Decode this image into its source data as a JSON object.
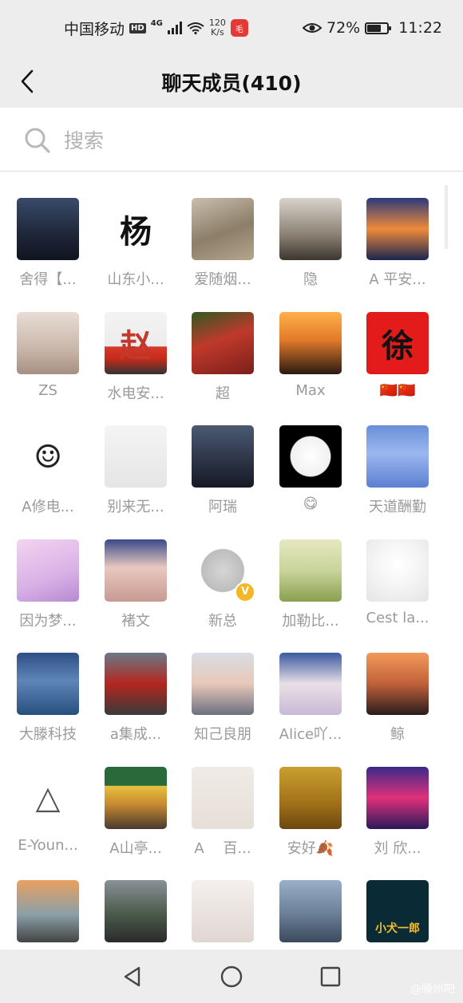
{
  "status_bar": {
    "carrier": "中国移动",
    "hd": "HD",
    "network": "4G",
    "speed_value": "120",
    "speed_unit": "K/s",
    "app_badge_text": "毛",
    "battery_percent": "72%",
    "battery_level": 0.72,
    "time": "11:22"
  },
  "header": {
    "title": "聊天成员(410)"
  },
  "search": {
    "placeholder": "搜索",
    "value": ""
  },
  "members": [
    {
      "name": "舍得【...",
      "bg": "linear-gradient(180deg,#3a4a6a 0%,#1d2638 60%,#10141f 100%)",
      "mark": "",
      "mark_color": "#ffffff"
    },
    {
      "name": "山东小...",
      "bg": "#ffffff",
      "mark": "杨",
      "mark_color": "#111111"
    },
    {
      "name": "爱随烟...",
      "bg": "linear-gradient(160deg,#c9bfae 0%,#8c7e68 55%,#b5a58d 100%)",
      "mark": "",
      "mark_color": "#ffffff"
    },
    {
      "name": "隐",
      "bg": "linear-gradient(180deg,#d9d4cc 0%,#8a7f72 60%,#3c3630 100%)",
      "mark": "",
      "mark_color": "#ffffff"
    },
    {
      "name": "A 平安...",
      "bg": "linear-gradient(180deg,#2b3a7a 0%,#f08a3a 50%,#1a2550 100%)",
      "mark": "",
      "mark_color": "#ffffff"
    },
    {
      "name": "ZS",
      "bg": "linear-gradient(180deg,#e8ddd5 0%,#c9b6aa 60%,#a58f82 100%)",
      "mark": "",
      "mark_color": "#ffffff"
    },
    {
      "name": "水电安...",
      "bg": "linear-gradient(180deg,#f3f3f3 0%,#ececec 55%,#d63a2a 56%,#c62a1a 75%,#333 100%)",
      "mark": "赵",
      "mark_color": "#c0392b"
    },
    {
      "name": "超",
      "bg": "linear-gradient(160deg,#2f5a22 0%,#c0392b 45%,#7a1f1a 100%)",
      "mark": "",
      "mark_color": "#ffffff"
    },
    {
      "name": "Max",
      "bg": "linear-gradient(180deg,#ffb04a 0%,#e27a2a 45%,#2a1a12 100%)",
      "mark": "",
      "mark_color": "#ffffff"
    },
    {
      "name": "🇨🇳🇨🇳",
      "bg": "#e31b1b",
      "mark": "徐",
      "mark_color": "#111111"
    },
    {
      "name": "A修电...",
      "bg": "#ffffff",
      "mark": "☺",
      "mark_color": "#222222"
    },
    {
      "name": "别来无...",
      "bg": "linear-gradient(180deg,#f4f4f4 0%,#e5e5e5 100%)",
      "mark": "",
      "mark_color": "#333333"
    },
    {
      "name": "阿瑞",
      "bg": "linear-gradient(180deg,#4a5a72 0%,#2a3244 60%,#151a24 100%)",
      "mark": "",
      "mark_color": "#ffffff"
    },
    {
      "name": "😋",
      "bg": "radial-gradient(circle at 50% 50%,#ffffff 0%,#f0f0f0 45%,#000000 47%,#000000 100%)",
      "mark": "",
      "mark_color": "#ffffff"
    },
    {
      "name": "天道酬勤",
      "bg": "linear-gradient(180deg,#6a8fd8 0%,#9bb7ef 45%,#5c7fd0 100%)",
      "mark": "",
      "mark_color": "#ffffff"
    },
    {
      "name": "因为梦...",
      "bg": "linear-gradient(160deg,#f2d4f0 0%,#d9b1e6 60%,#b58ad0 100%)",
      "mark": "",
      "mark_color": "#ffffff"
    },
    {
      "name": "褚文",
      "bg": "linear-gradient(180deg,#3a4a8a 0%,#e8c8c0 45%,#c79a90 100%)",
      "mark": "",
      "mark_color": "#ffffff"
    },
    {
      "name": "新总",
      "bg": "radial-gradient(circle at 50% 50%,#d6d6d6 0%,#bdbdbd 48%,#ffffff 50%)",
      "mark": "",
      "mark_color": "#ffffff",
      "verified": "V"
    },
    {
      "name": "加勒比...",
      "bg": "linear-gradient(180deg,#e6e8c0 0%,#c8d49a 50%,#8aa050 100%)",
      "mark": "",
      "mark_color": "#ffffff"
    },
    {
      "name": "Cest la...",
      "bg": "radial-gradient(circle at 50% 40%,#ffffff 0%,#f6f6f6 40%,#e4e4e4 100%)",
      "mark": "",
      "mark_color": "#222222"
    },
    {
      "name": "大滕科技",
      "bg": "linear-gradient(180deg,#2e4f86 0%,#5f85b8 45%,#28507e 100%)",
      "mark": "",
      "mark_color": "#ffffff"
    },
    {
      "name": "a集成...",
      "bg": "linear-gradient(180deg,#6a7a88 0%,#b3261e 50%,#3a3a3a 100%)",
      "mark": "",
      "mark_color": "#ffffff"
    },
    {
      "name": "知己良朋",
      "bg": "linear-gradient(180deg,#d8dde5 0%,#e8c8b8 50%,#6a7080 100%)",
      "mark": "",
      "mark_color": "#ffffff"
    },
    {
      "name": "Alice吖...",
      "bg": "linear-gradient(180deg,#3a5aa0 0%,#e9dfe6 50%,#c8b9d6 100%)",
      "mark": "",
      "mark_color": "#ffffff"
    },
    {
      "name": "鲸",
      "bg": "linear-gradient(180deg,#f29a5a 0%,#c0603a 50%,#2a1c1c 100%)",
      "mark": "",
      "mark_color": "#ffffff"
    },
    {
      "name": "E-Youn...",
      "bg": "#ffffff",
      "mark": "△",
      "mark_color": "#555555"
    },
    {
      "name": "A山亭...",
      "bg": "linear-gradient(180deg,#2a6a3a 0%,#2a6a3a 30%,#e8c040 31%,#c88a30 60%,#4a3a30 100%)",
      "mark": "",
      "mark_color": "#ffffff"
    },
    {
      "name": "A　 百...",
      "bg": "linear-gradient(180deg,#f0ebe6 0%,#e6dfd8 100%)",
      "mark": "",
      "mark_color": "#333333"
    },
    {
      "name": "安好🍂",
      "bg": "linear-gradient(180deg,#c9a030 0%,#a07018 60%,#6a4810 100%)",
      "mark": "",
      "mark_color": "#ffffff"
    },
    {
      "name": "刘 欣...",
      "bg": "linear-gradient(180deg,#3a2a8a 0%,#e0307a 50%,#2a1a5a 100%)",
      "mark": "",
      "mark_color": "#ffffff"
    },
    {
      "name": "",
      "bg": "linear-gradient(180deg,#e8a060 0%,#8aa0a8 55%,#444 100%)",
      "mark": "",
      "mark_color": "#ffffff"
    },
    {
      "name": "",
      "bg": "linear-gradient(180deg,#8a9098 0%,#4a5a4a 55%,#2a2a2a 100%)",
      "mark": "",
      "mark_color": "#ffffff"
    },
    {
      "name": "",
      "bg": "linear-gradient(180deg,#f4f0ee 0%,#e0d6d2 100%)",
      "mark": "",
      "mark_color": "#333333"
    },
    {
      "name": "",
      "bg": "linear-gradient(180deg,#9ab0c8 0%,#6a7e96 55%,#3a4a5e 100%)",
      "mark": "",
      "mark_color": "#ffffff"
    },
    {
      "name": "",
      "bg": "#0a2a36",
      "mark": "小犬一郎",
      "mark_color": "#f0c030"
    }
  ],
  "system_nav": {
    "back": "back-triangle",
    "home": "home-circle",
    "recents": "recents-square"
  },
  "watermark": "@滕州吧"
}
